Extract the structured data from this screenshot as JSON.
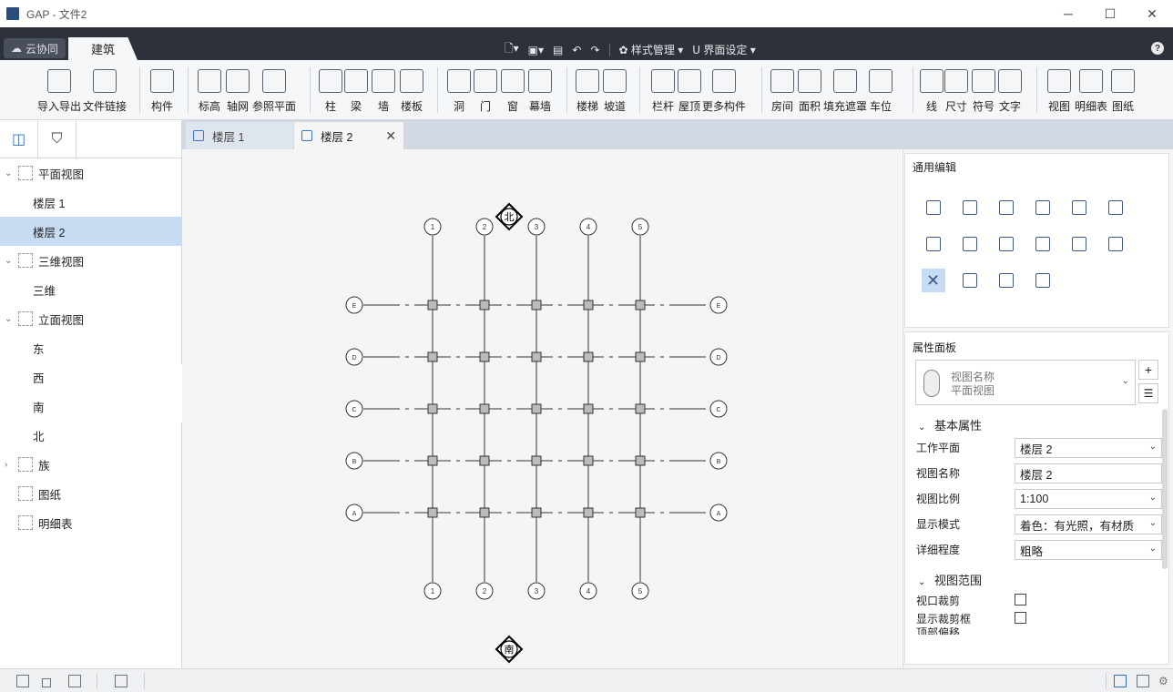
{
  "window": {
    "title": "GAP - 文件2",
    "minimize": "─",
    "maximize": "☐",
    "close": "✕"
  },
  "ribbon": {
    "cloud_label": "云协同",
    "active_tab": "建筑",
    "style_mgmt": "样式管理",
    "ui_settings": "界面设定",
    "help": "?"
  },
  "toolbar": {
    "items": [
      "导入导出",
      "文件链接",
      "构件",
      "标高",
      "轴网",
      "参照平面",
      "柱",
      "梁",
      "墙",
      "楼板",
      "洞",
      "门",
      "窗",
      "幕墙",
      "楼梯",
      "坡道",
      "栏杆",
      "屋顶",
      "更多构件",
      "房间",
      "面积",
      "填充遮罩",
      "车位",
      "线",
      "尺寸",
      "符号",
      "文字",
      "视图",
      "明细表",
      "图纸"
    ]
  },
  "tree": {
    "nodes": [
      {
        "label": "平面视图"
      },
      {
        "label": "楼层 1"
      },
      {
        "label": "楼层 2"
      },
      {
        "label": "三维视图"
      },
      {
        "label": "三维"
      },
      {
        "label": "立面视图"
      },
      {
        "label": "东"
      },
      {
        "label": "西"
      },
      {
        "label": "南"
      },
      {
        "label": "北"
      },
      {
        "label": "族"
      },
      {
        "label": "图纸"
      },
      {
        "label": "明细表"
      }
    ]
  },
  "doc_tabs": [
    {
      "label": "楼层 1"
    },
    {
      "label": "楼层 2"
    }
  ],
  "plan": {
    "north_label": "北",
    "south_label": "南",
    "top_axis_labels": [
      "1",
      "2",
      "3",
      "4",
      "5"
    ],
    "bottom_axis_labels": [
      "1",
      "2",
      "3",
      "4",
      "5"
    ],
    "left_axis_labels": [
      "E",
      "D",
      "C",
      "B",
      "A"
    ],
    "right_axis_labels": [
      "E",
      "D",
      "C",
      "B",
      "A"
    ]
  },
  "right_panel": {
    "general_edit_title": "通用编辑",
    "prop_panel_title": "属性面板",
    "type_selector": {
      "line1": "视图名称",
      "line2": "平面视图"
    },
    "basic_section": "基本属性",
    "props": [
      {
        "label": "工作平面",
        "value": "楼层 2"
      },
      {
        "label": "视图名称",
        "value": "楼层 2"
      },
      {
        "label": "视图比例",
        "value": "1:100"
      },
      {
        "label": "显示模式",
        "value": "着色：有光照，有材质"
      },
      {
        "label": "详细程度",
        "value": "粗略"
      }
    ],
    "range_section": "视图范围",
    "checks": [
      {
        "label": "视口裁剪",
        "checked": false
      },
      {
        "label": "显示裁剪框",
        "checked": false
      }
    ],
    "cut_label": "顶部偏移"
  },
  "colors": {
    "accent": "#2f6fc2",
    "dark": "#2c313a",
    "selected": "#c7dcf3"
  }
}
